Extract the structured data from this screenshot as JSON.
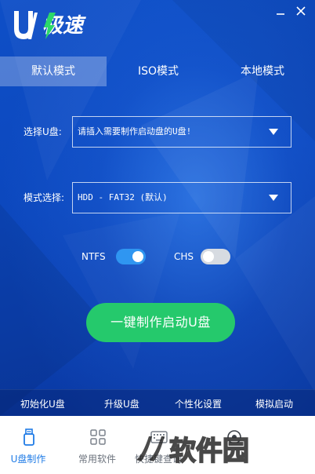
{
  "window": {
    "logo_name": "U-accel-logo",
    "minimize": "minimize-icon",
    "close": "close-icon"
  },
  "tabs": [
    {
      "label": "默认模式",
      "active": true
    },
    {
      "label": "ISO模式",
      "active": false
    },
    {
      "label": "本地模式",
      "active": false
    }
  ],
  "form": {
    "usb": {
      "label": "选择U盘:",
      "value": "请插入需要制作启动盘的U盘!"
    },
    "mode": {
      "label": "模式选择:",
      "value": "HDD - FAT32 (默认)"
    }
  },
  "toggles": {
    "ntfs": {
      "label": "NTFS",
      "on": true
    },
    "chs": {
      "label": "CHS",
      "on": false
    }
  },
  "primary_action": "一键制作启动U盘",
  "tools": [
    "初始化U盘",
    "升级U盘",
    "个性化设置",
    "模拟启动"
  ],
  "bottom_nav": [
    {
      "label": "U盘制作",
      "icon": "usb-drive-icon",
      "active": true
    },
    {
      "label": "常用软件",
      "icon": "apps-grid-icon",
      "active": false
    },
    {
      "label": "快捷键查询",
      "icon": "keyboard-icon",
      "active": false
    },
    {
      "label": "",
      "icon": "more-icon",
      "active": false
    }
  ],
  "colors": {
    "accent_green": "#25c96c",
    "active_nav": "#1f7be6",
    "background": "#0c47bd"
  }
}
